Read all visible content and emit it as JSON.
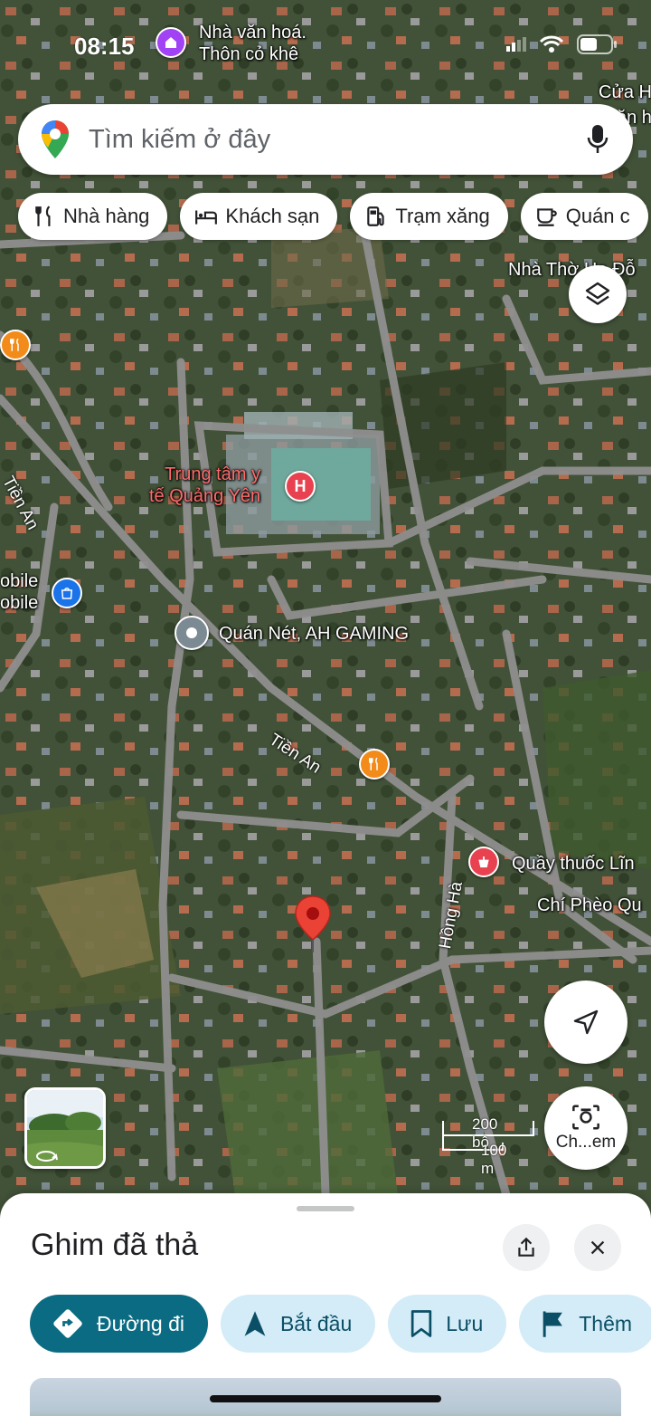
{
  "status_bar": {
    "time": "08:15"
  },
  "search": {
    "placeholder": "Tìm kiếm ở đây"
  },
  "chips": [
    {
      "label": "Nhà hàng",
      "icon": "fork-knife-icon"
    },
    {
      "label": "Khách sạn",
      "icon": "bed-icon"
    },
    {
      "label": "Trạm xăng",
      "icon": "gas-pump-icon"
    },
    {
      "label": "Quán c",
      "icon": "coffee-cup-icon"
    }
  ],
  "map": {
    "labels": {
      "cultural_house": "Nhà văn hoá.\nThôn cỏ khê",
      "top_right": "Cửa H",
      "top_right_2": "văn h",
      "church": "Nhà Thờ Họ Đỗ",
      "medical_center": "Trung tâm y\ntế Quảng Yên",
      "mobile": "obile\nobile",
      "gaming": "Quán Nét, AH GAMING",
      "pharmacy": "Quầy thuốc Lĩn",
      "chi_pheo": "Chí Phèo Qu"
    },
    "roads": {
      "tien_an": "Tiền An",
      "tien_an_left": "Tiền An",
      "hong_ha": "Hồng Hà"
    },
    "scale": {
      "ft": "200 bộ",
      "m": "100 m"
    }
  },
  "lens_button": {
    "label": "Ch...em"
  },
  "sheet": {
    "title": "Ghim đã thả",
    "actions": [
      {
        "label": "Đường đi",
        "icon": "directions-icon"
      },
      {
        "label": "Bắt đầu",
        "icon": "navigation-arrow-icon"
      },
      {
        "label": "Lưu",
        "icon": "bookmark-icon"
      },
      {
        "label": "Thêm",
        "icon": "flag-icon"
      }
    ]
  },
  "colors": {
    "primary_action": "#0b6b83",
    "secondary_action": "#d3ecf7",
    "hospital_poi": "#e8414f",
    "food_poi": "#f28b1a",
    "shop_poi": "#1a73e8",
    "pin": "#ea4335"
  }
}
